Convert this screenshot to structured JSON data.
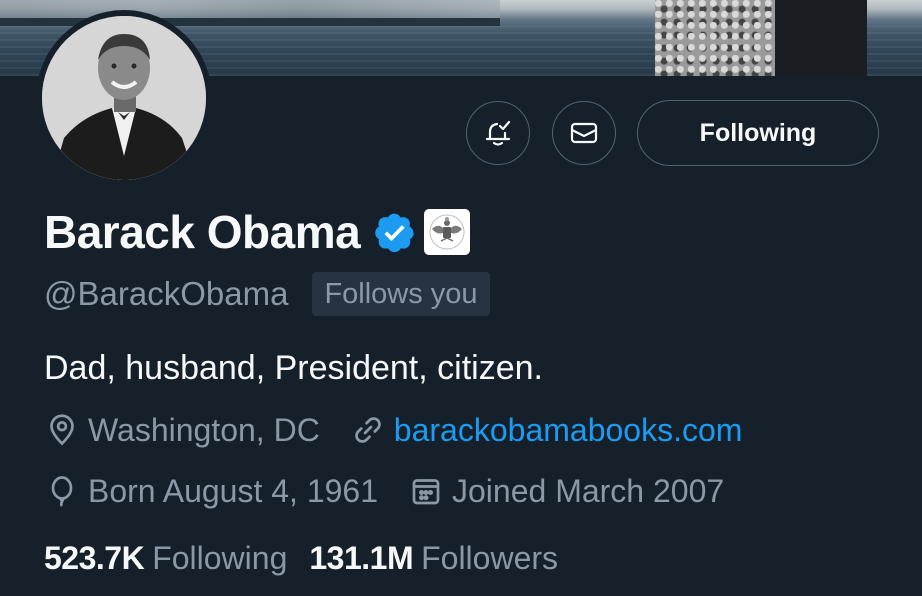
{
  "profile": {
    "name": "Barack Obama",
    "handle": "@BarackObama",
    "follows_you": "Follows you",
    "bio": "Dad, husband, President, citizen.",
    "location": "Washington, DC",
    "website": "barackobamabooks.com",
    "born": "Born August 4, 1961",
    "joined": "Joined March 2007"
  },
  "actions": {
    "follow_label": "Following",
    "notify_icon": "bell-check-icon",
    "message_icon": "envelope-icon"
  },
  "stats": {
    "following_count": "523.7K",
    "following_label": "Following",
    "followers_count": "131.1M",
    "followers_label": "Followers"
  },
  "colors": {
    "background": "#15202b",
    "text_primary": "#f7f9f9",
    "text_secondary": "#8b98a5",
    "accent": "#1d9bf0",
    "border": "#536471"
  }
}
